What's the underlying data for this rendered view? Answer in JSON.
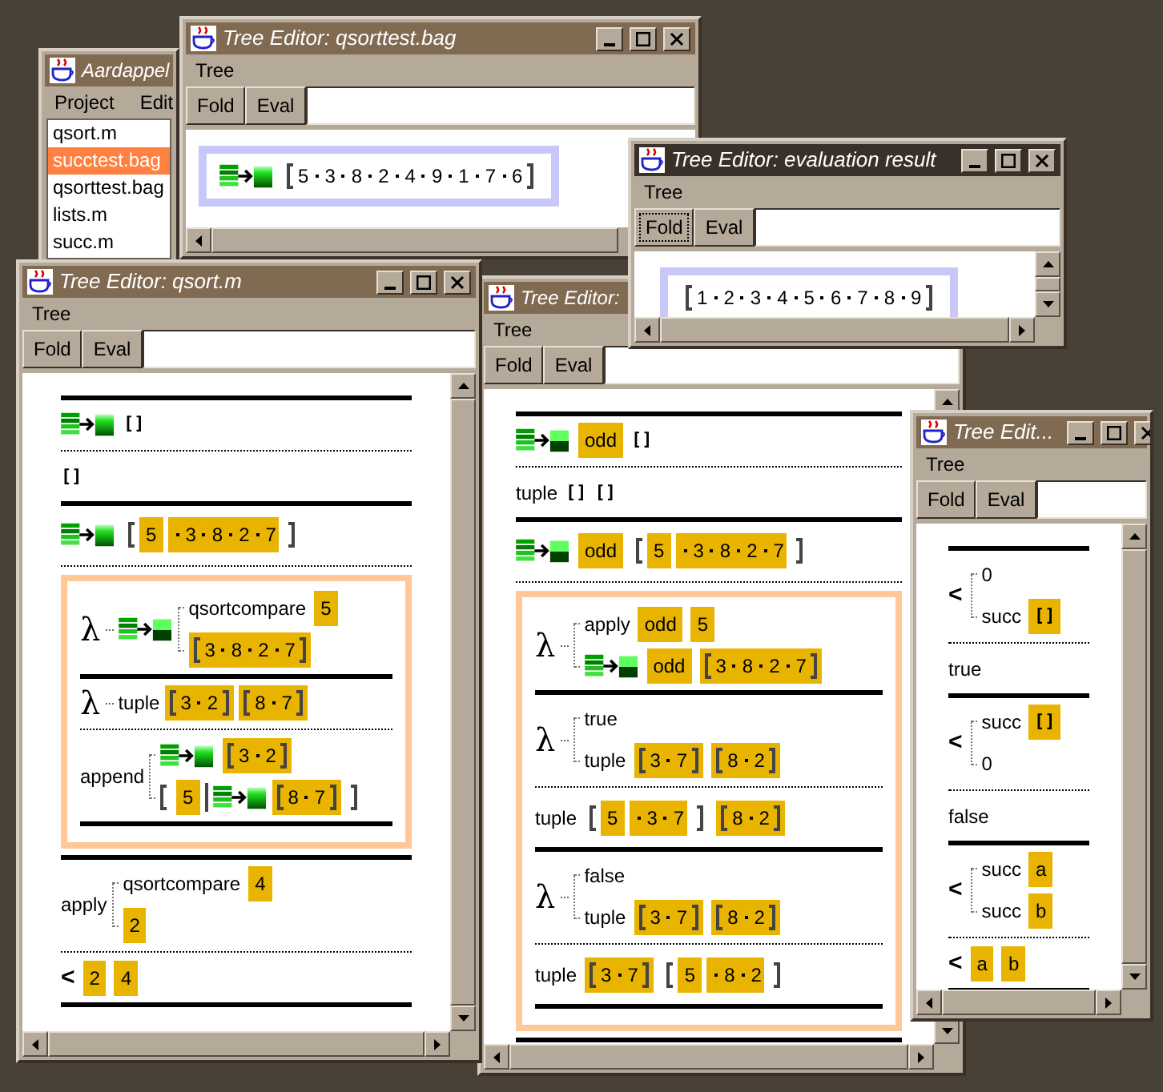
{
  "windows": [
    {
      "kind": "browser",
      "title": "Aardappel",
      "active": false,
      "menu": [
        "Project",
        "Edit"
      ],
      "files": [
        {
          "name": "qsort.m",
          "selected": false
        },
        {
          "name": "succtest.bag",
          "selected": true
        },
        {
          "name": "qsorttest.bag",
          "selected": false
        },
        {
          "name": "lists.m",
          "selected": false
        },
        {
          "name": "succ.m",
          "selected": false
        }
      ]
    },
    {
      "kind": "editor",
      "title": "Tree Editor: qsorttest.bag",
      "active": false,
      "menu": [
        "Tree"
      ],
      "buttons": [
        {
          "label": "Fold",
          "focused": false
        },
        {
          "label": "Eval",
          "focused": false
        }
      ],
      "lines": [
        {
          "kind": "selection",
          "lines": [
            {
              "kind": "row",
              "items": [
                {
                  "kind": "func"
                },
                {
                  "kind": "list",
                  "hl": false,
                  "items": [
                    "5",
                    "3",
                    "8",
                    "2",
                    "4",
                    "9",
                    "1",
                    "7",
                    "6"
                  ]
                }
              ]
            }
          ]
        }
      ]
    },
    {
      "kind": "editor",
      "title": "Tree Editor: qsort.m",
      "active": false,
      "menu": [
        "Tree"
      ],
      "buttons": [
        {
          "label": "Fold",
          "focused": false
        },
        {
          "label": "Eval",
          "focused": false
        }
      ],
      "lines": [
        {
          "kind": "rule"
        },
        {
          "kind": "row",
          "items": [
            {
              "kind": "func"
            },
            {
              "kind": "nil",
              "text": "[]",
              "hl": false
            }
          ]
        },
        {
          "kind": "separator"
        },
        {
          "kind": "row",
          "items": [
            {
              "kind": "nil",
              "text": "[]",
              "hl": false
            }
          ]
        },
        {
          "kind": "rule"
        },
        {
          "kind": "row",
          "items": [
            {
              "kind": "func"
            },
            {
              "kind": "list",
              "hl": false,
              "items": [
                {
                  "kind": "word",
                  "text": "5",
                  "hl": true
                },
                {
                  "kind": "seg",
                  "hl": true,
                  "items": [
                    "3",
                    "8",
                    "2",
                    "7"
                  ]
                }
              ]
            }
          ]
        },
        {
          "kind": "separator"
        },
        {
          "kind": "frame",
          "lines": [
            {
              "kind": "row",
              "items": [
                {
                  "kind": "lambda",
                  "text": "λ",
                  "body": [
                    {
                      "kind": "split"
                    },
                    {
                      "kind": "branch",
                      "arms": [
                        [
                          {
                            "kind": "word",
                            "text": "qsortcompare",
                            "hl": false
                          },
                          {
                            "kind": "word",
                            "text": "5",
                            "hl": true
                          }
                        ],
                        [
                          {
                            "kind": "list",
                            "hl": true,
                            "items": [
                              "3",
                              "8",
                              "2",
                              "7"
                            ]
                          }
                        ]
                      ]
                    }
                  ]
                }
              ]
            },
            {
              "kind": "rule"
            },
            {
              "kind": "row",
              "items": [
                {
                  "kind": "lambda",
                  "text": "λ",
                  "body": [
                    {
                      "kind": "word",
                      "text": "tuple",
                      "hl": false
                    },
                    {
                      "kind": "list",
                      "hl": true,
                      "items": [
                        "3",
                        "2"
                      ]
                    },
                    {
                      "kind": "list",
                      "hl": true,
                      "items": [
                        "8",
                        "7"
                      ]
                    }
                  ]
                }
              ]
            },
            {
              "kind": "separator"
            },
            {
              "kind": "row",
              "items": [
                {
                  "kind": "branch",
                  "head": [
                    {
                      "kind": "word",
                      "text": "append",
                      "hl": false
                    }
                  ],
                  "arms": [
                    [
                      {
                        "kind": "func"
                      },
                      {
                        "kind": "list",
                        "hl": true,
                        "items": [
                          "3",
                          "2"
                        ]
                      }
                    ],
                    [
                      {
                        "kind": "cons",
                        "head": {
                          "kind": "word",
                          "text": "5",
                          "hl": true
                        },
                        "tail": [
                          {
                            "kind": "func"
                          },
                          {
                            "kind": "list",
                            "hl": true,
                            "items": [
                              "8",
                              "7"
                            ]
                          }
                        ]
                      }
                    ]
                  ]
                }
              ]
            },
            {
              "kind": "rule"
            }
          ]
        },
        {
          "kind": "rule"
        },
        {
          "kind": "row",
          "items": [
            {
              "kind": "branch",
              "head": [
                {
                  "kind": "word",
                  "text": "apply",
                  "hl": false
                }
              ],
              "arms": [
                [
                  {
                    "kind": "word",
                    "text": "qsortcompare",
                    "hl": false
                  },
                  {
                    "kind": "word",
                    "text": "4",
                    "hl": true
                  }
                ],
                [
                  {
                    "kind": "word",
                    "text": "2",
                    "hl": true
                  }
                ]
              ]
            }
          ]
        },
        {
          "kind": "separator"
        },
        {
          "kind": "row",
          "items": [
            {
              "kind": "less",
              "text": "<"
            },
            {
              "kind": "word",
              "text": "2",
              "hl": true
            },
            {
              "kind": "word",
              "text": "4",
              "hl": true
            }
          ]
        },
        {
          "kind": "rule"
        }
      ]
    },
    {
      "kind": "editor",
      "title": "Tree Editor:",
      "active": false,
      "menu": [
        "Tree"
      ],
      "buttons": [
        {
          "label": "Fold",
          "focused": false
        },
        {
          "label": "Eval",
          "focused": false
        }
      ],
      "lines": [
        {
          "kind": "rule"
        },
        {
          "kind": "row",
          "items": [
            {
              "kind": "split"
            },
            {
              "kind": "word",
              "text": "odd",
              "hl": true
            },
            {
              "kind": "nil",
              "text": "[]",
              "hl": false
            }
          ]
        },
        {
          "kind": "separator"
        },
        {
          "kind": "row",
          "items": [
            {
              "kind": "word",
              "text": "tuple",
              "hl": false
            },
            {
              "kind": "nil",
              "text": "[]",
              "hl": false
            },
            {
              "kind": "nil",
              "text": "[]",
              "hl": false
            }
          ]
        },
        {
          "kind": "rule"
        },
        {
          "kind": "row",
          "items": [
            {
              "kind": "split"
            },
            {
              "kind": "word",
              "text": "odd",
              "hl": true
            },
            {
              "kind": "list",
              "hl": false,
              "items": [
                {
                  "kind": "word",
                  "text": "5",
                  "hl": true
                },
                {
                  "kind": "seg",
                  "hl": true,
                  "items": [
                    "3",
                    "8",
                    "2",
                    "7"
                  ]
                }
              ]
            }
          ]
        },
        {
          "kind": "separator"
        },
        {
          "kind": "frame",
          "lines": [
            {
              "kind": "row",
              "items": [
                {
                  "kind": "lambda",
                  "text": "λ",
                  "body": [
                    {
                      "kind": "branch",
                      "arms": [
                        [
                          {
                            "kind": "word",
                            "text": "apply",
                            "hl": false
                          },
                          {
                            "kind": "word",
                            "text": "odd",
                            "hl": true
                          },
                          {
                            "kind": "word",
                            "text": "5",
                            "hl": true
                          }
                        ],
                        [
                          {
                            "kind": "split"
                          },
                          {
                            "kind": "word",
                            "text": "odd",
                            "hl": true
                          },
                          {
                            "kind": "list",
                            "hl": true,
                            "items": [
                              "3",
                              "8",
                              "2",
                              "7"
                            ]
                          }
                        ]
                      ]
                    }
                  ]
                }
              ]
            },
            {
              "kind": "rule"
            },
            {
              "kind": "row",
              "items": [
                {
                  "kind": "lambda",
                  "text": "λ",
                  "body": [
                    {
                      "kind": "branch",
                      "arms": [
                        [
                          {
                            "kind": "word",
                            "text": "true",
                            "hl": false
                          }
                        ],
                        [
                          {
                            "kind": "word",
                            "text": "tuple",
                            "hl": false
                          },
                          {
                            "kind": "list",
                            "hl": true,
                            "items": [
                              "3",
                              "7"
                            ]
                          },
                          {
                            "kind": "list",
                            "hl": true,
                            "items": [
                              "8",
                              "2"
                            ]
                          }
                        ]
                      ]
                    }
                  ]
                }
              ]
            },
            {
              "kind": "separator"
            },
            {
              "kind": "row",
              "items": [
                {
                  "kind": "word",
                  "text": "tuple",
                  "hl": false
                },
                {
                  "kind": "list",
                  "hl": false,
                  "items": [
                    {
                      "kind": "word",
                      "text": "5",
                      "hl": true
                    },
                    {
                      "kind": "seg",
                      "hl": true,
                      "items": [
                        "3",
                        "7"
                      ]
                    }
                  ]
                },
                {
                  "kind": "list",
                  "hl": true,
                  "items": [
                    "8",
                    "2"
                  ]
                }
              ]
            },
            {
              "kind": "rule"
            },
            {
              "kind": "row",
              "items": [
                {
                  "kind": "lambda",
                  "text": "λ",
                  "body": [
                    {
                      "kind": "branch",
                      "arms": [
                        [
                          {
                            "kind": "word",
                            "text": "false",
                            "hl": false
                          }
                        ],
                        [
                          {
                            "kind": "word",
                            "text": "tuple",
                            "hl": false
                          },
                          {
                            "kind": "list",
                            "hl": true,
                            "items": [
                              "3",
                              "7"
                            ]
                          },
                          {
                            "kind": "list",
                            "hl": true,
                            "items": [
                              "8",
                              "2"
                            ]
                          }
                        ]
                      ]
                    }
                  ]
                }
              ]
            },
            {
              "kind": "separator"
            },
            {
              "kind": "row",
              "items": [
                {
                  "kind": "word",
                  "text": "tuple",
                  "hl": false
                },
                {
                  "kind": "list",
                  "hl": true,
                  "items": [
                    "3",
                    "7"
                  ]
                },
                {
                  "kind": "list",
                  "hl": false,
                  "items": [
                    {
                      "kind": "word",
                      "text": "5",
                      "hl": true
                    },
                    {
                      "kind": "seg",
                      "hl": true,
                      "items": [
                        "8",
                        "2"
                      ]
                    }
                  ]
                }
              ]
            },
            {
              "kind": "rule"
            }
          ]
        },
        {
          "kind": "rule"
        }
      ]
    },
    {
      "kind": "editor",
      "title": "Tree Editor: evaluation result",
      "active": true,
      "menu": [
        "Tree"
      ],
      "buttons": [
        {
          "label": "Fold",
          "focused": true
        },
        {
          "label": "Eval",
          "focused": false
        }
      ],
      "lines": [
        {
          "kind": "selection",
          "lines": [
            {
              "kind": "row",
              "items": [
                {
                  "kind": "list",
                  "hl": false,
                  "items": [
                    "1",
                    "2",
                    "3",
                    "4",
                    "5",
                    "6",
                    "7",
                    "8",
                    "9"
                  ]
                }
              ]
            }
          ]
        }
      ]
    },
    {
      "kind": "editor",
      "title": "Tree Edit...",
      "active": false,
      "menu": [
        "Tree"
      ],
      "buttons": [
        {
          "label": "Fold",
          "focused": false
        },
        {
          "label": "Eval",
          "focused": false
        }
      ],
      "lines": [
        {
          "kind": "rule"
        },
        {
          "kind": "row",
          "items": [
            {
              "kind": "less",
              "text": "<"
            },
            {
              "kind": "branch",
              "arms": [
                [
                  {
                    "kind": "word",
                    "text": "0",
                    "hl": false
                  }
                ],
                [
                  {
                    "kind": "word",
                    "text": "succ",
                    "hl": false
                  },
                  {
                    "kind": "nil",
                    "text": "[]",
                    "hl": true
                  }
                ]
              ]
            }
          ]
        },
        {
          "kind": "separator"
        },
        {
          "kind": "row",
          "items": [
            {
              "kind": "word",
              "text": "true",
              "hl": false
            }
          ]
        },
        {
          "kind": "rule"
        },
        {
          "kind": "row",
          "items": [
            {
              "kind": "less",
              "text": "<"
            },
            {
              "kind": "branch",
              "arms": [
                [
                  {
                    "kind": "word",
                    "text": "succ",
                    "hl": false
                  },
                  {
                    "kind": "nil",
                    "text": "[]",
                    "hl": true
                  }
                ],
                [
                  {
                    "kind": "word",
                    "text": "0",
                    "hl": false
                  }
                ]
              ]
            }
          ]
        },
        {
          "kind": "separator"
        },
        {
          "kind": "row",
          "items": [
            {
              "kind": "word",
              "text": "false",
              "hl": false
            }
          ]
        },
        {
          "kind": "rule"
        },
        {
          "kind": "row",
          "items": [
            {
              "kind": "less",
              "text": "<"
            },
            {
              "kind": "branch",
              "arms": [
                [
                  {
                    "kind": "word",
                    "text": "succ",
                    "hl": false
                  },
                  {
                    "kind": "word",
                    "text": "a",
                    "hl": true
                  }
                ],
                [
                  {
                    "kind": "word",
                    "text": "succ",
                    "hl": false
                  },
                  {
                    "kind": "word",
                    "text": "b",
                    "hl": true
                  }
                ]
              ]
            }
          ]
        },
        {
          "kind": "separator"
        },
        {
          "kind": "row",
          "items": [
            {
              "kind": "less",
              "text": "<"
            },
            {
              "kind": "word",
              "text": "a",
              "hl": true
            },
            {
              "kind": "word",
              "text": "b",
              "hl": true
            }
          ]
        },
        {
          "kind": "rule"
        }
      ]
    }
  ]
}
